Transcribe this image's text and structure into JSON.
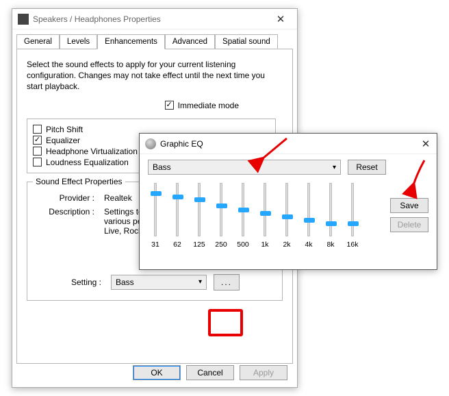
{
  "speakers_window": {
    "title": "Speakers / Headphones Properties",
    "tabs": [
      "General",
      "Levels",
      "Enhancements",
      "Advanced",
      "Spatial sound"
    ],
    "active_tab_index": 2,
    "intro": "Select the sound effects to apply for your current listening configuration. Changes may not take effect until the next time you start playback.",
    "immediate_mode_label": "Immediate mode",
    "immediate_mode_checked": true,
    "effects": [
      {
        "label": "Pitch Shift",
        "checked": false
      },
      {
        "label": "Equalizer",
        "checked": true
      },
      {
        "label": "Headphone Virtualization",
        "checked": false
      },
      {
        "label": "Loudness Equalization",
        "checked": false
      }
    ],
    "properties_group_title": "Sound Effect Properties",
    "provider_label": "Provider :",
    "provider_value": "Realtek",
    "description_label": "Description :",
    "description_value": "Settings to enhance sound for various performance types e.g. Live, Rock, etc.",
    "description_value_truncated": "Settings to e\nvarious perfo\nLive, Rock, e",
    "setting_label": "Setting :",
    "setting_value": "Bass",
    "more_button_label": "...",
    "buttons": {
      "ok": "OK",
      "cancel": "Cancel",
      "apply": "Apply"
    }
  },
  "eq_window": {
    "title": "Graphic EQ",
    "preset": "Bass",
    "reset_label": "Reset",
    "save_label": "Save",
    "delete_label": "Delete",
    "bands": [
      {
        "freq": "31",
        "value": 85
      },
      {
        "freq": "62",
        "value": 78
      },
      {
        "freq": "125",
        "value": 72
      },
      {
        "freq": "250",
        "value": 60
      },
      {
        "freq": "500",
        "value": 52
      },
      {
        "freq": "1k",
        "value": 45
      },
      {
        "freq": "2k",
        "value": 38
      },
      {
        "freq": "4k",
        "value": 31
      },
      {
        "freq": "8k",
        "value": 24
      },
      {
        "freq": "16k",
        "value": 24
      }
    ]
  },
  "annotations": {
    "arrow_more_button": true,
    "arrow_eq_top": true,
    "arrow_save": true
  }
}
